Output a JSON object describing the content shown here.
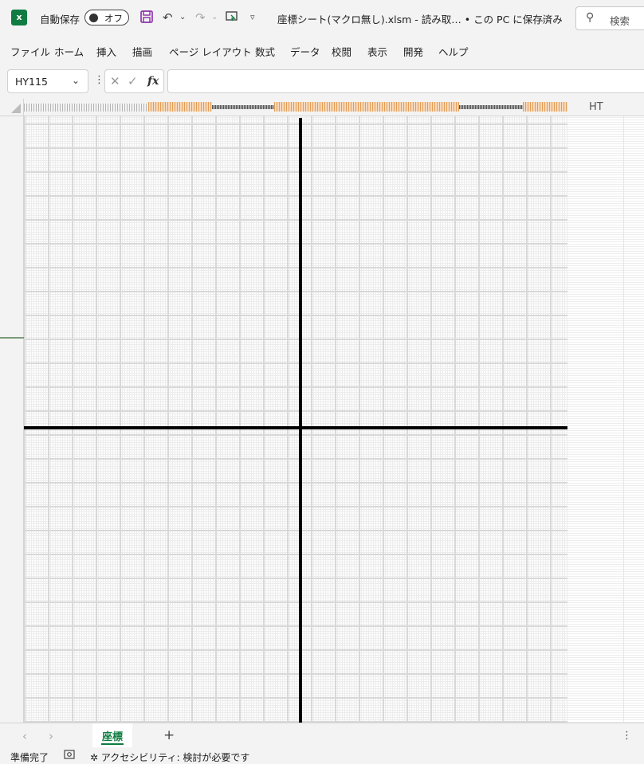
{
  "titlebar": {
    "app_icon": "excel-logo",
    "app_icon_letter": "x",
    "autosave_label": "自動保存",
    "autosave_state": "オフ",
    "icons": [
      "save-icon",
      "undo-icon",
      "redo-icon",
      "presentation-icon",
      "customize-qat-icon"
    ],
    "document_title": "座標シート(マクロ無し).xlsm  -  読み取… • この PC に保存済み",
    "search_placeholder": "検索"
  },
  "ribbon": {
    "tabs": [
      "ファイル",
      "ホーム",
      "挿入",
      "描画",
      "ページ レイアウト",
      "数式",
      "データ",
      "校閲",
      "表示",
      "開発",
      "ヘルプ"
    ]
  },
  "formula_bar": {
    "name_box": "HY115",
    "formula": "",
    "fx_label": "fx"
  },
  "sheet": {
    "column_header_label": "HT",
    "grid_color": "#d8d8d8",
    "axis_color": "#000000"
  },
  "sheet_tabs": {
    "active": "座標",
    "add_label": "+",
    "accent": "#107c41"
  },
  "status": {
    "ready": "準備完了",
    "accessibility": "アクセシビリティ: 検討が必要です"
  }
}
